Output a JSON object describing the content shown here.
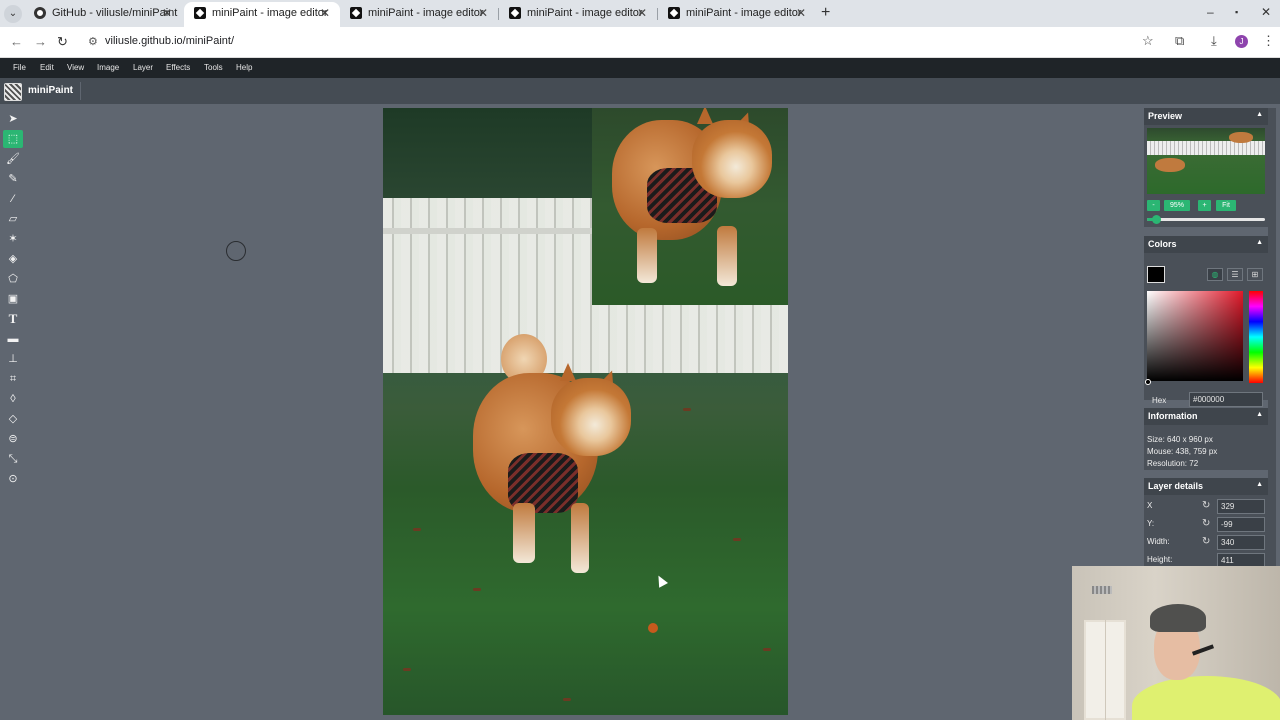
{
  "browser": {
    "tabs": [
      {
        "title": "GitHub - viliusle/miniPaint",
        "active": false,
        "icon": "github-icon"
      },
      {
        "title": "miniPaint - image editor",
        "active": true,
        "icon": "minipaint-icon"
      },
      {
        "title": "miniPaint - image editor",
        "active": false,
        "icon": "minipaint-icon"
      },
      {
        "title": "miniPaint - image editor",
        "active": false,
        "icon": "minipaint-icon"
      },
      {
        "title": "miniPaint - image editor",
        "active": false,
        "icon": "minipaint-icon"
      }
    ],
    "url": "viliusle.github.io/miniPaint/",
    "profile_initial": "J",
    "profile_color": "#8e44ad"
  },
  "app": {
    "menu": [
      "File",
      "Edit",
      "View",
      "Image",
      "Layer",
      "Effects",
      "Tools",
      "Help"
    ],
    "title": "miniPaint",
    "accent_color": "#2bb673",
    "tools": [
      "select-tool-icon",
      "selection-tool-icon",
      "brush-tool-icon",
      "pencil-tool-icon",
      "pick-color-tool-icon",
      "erase-tool-icon",
      "magic-wand-tool-icon",
      "fill-tool-icon",
      "shape-tool-icon",
      "media-tool-icon",
      "text-tool-icon",
      "gradient-tool-icon",
      "clone-tool-icon",
      "crop-tool-icon",
      "blur-tool-icon",
      "sharpen-tool-icon",
      "bulge-pinch-tool-icon",
      "desaturate-tool-icon",
      "animation-tool-icon"
    ],
    "active_tool": "selection-tool-icon"
  },
  "panels": {
    "preview": {
      "title": "Preview",
      "zoom_minus": "-",
      "zoom_value": "95%",
      "zoom_plus": "+",
      "zoom_fit": "Fit",
      "zoom_level": 0.08
    },
    "colors": {
      "title": "Colors",
      "hex_label": "Hex",
      "hex_value": "#000000",
      "current_color": "#000000",
      "hue_color": "#e0192a"
    },
    "information": {
      "title": "Information",
      "size": "Size: 640 x 960 px",
      "mouse": "Mouse: 438, 759 px",
      "resolution": "Resolution: 72"
    },
    "layer_details": {
      "title": "Layer details",
      "x_label": "X",
      "x_value": "329",
      "y_label": "Y:",
      "y_value": "-99",
      "width_label": "Width:",
      "width_value": "340",
      "height_label": "Height:",
      "height_value": "411"
    }
  }
}
